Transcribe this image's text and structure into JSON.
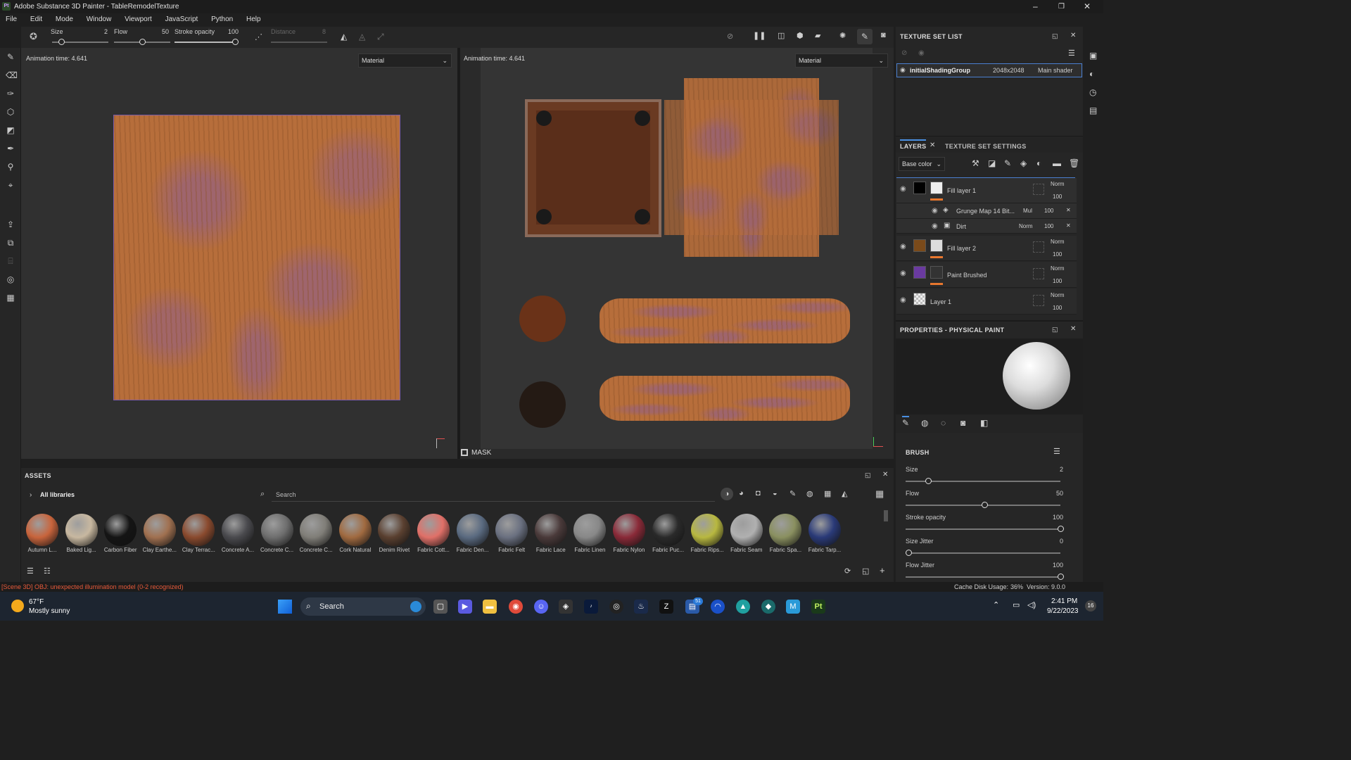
{
  "window": {
    "title": "Adobe Substance 3D Painter - TableRemodelTexture",
    "app_icon": "Pt"
  },
  "menu": [
    "File",
    "Edit",
    "Mode",
    "Window",
    "Viewport",
    "JavaScript",
    "Python",
    "Help"
  ],
  "toolbar": {
    "size_label": "Size",
    "size_value": "2",
    "flow_label": "Flow",
    "flow_value": "50",
    "opacity_label": "Stroke opacity",
    "opacity_value": "100",
    "distance_label": "Distance",
    "distance_value": "8"
  },
  "viewport_left": {
    "animation_time": "Animation time: 4.641",
    "channel": "Material"
  },
  "viewport_right": {
    "animation_time": "Animation time: 4.641",
    "channel": "Material",
    "mask_label": "MASK"
  },
  "texture_set_list": {
    "title": "TEXTURE SET LIST",
    "row": {
      "name": "initialShadingGroup",
      "resolution": "2048x2048",
      "shader": "Main shader"
    }
  },
  "layers": {
    "tab_layers": "LAYERS",
    "tab_settings": "TEXTURE SET SETTINGS",
    "channel": "Base color",
    "items": [
      {
        "name": "Fill layer 1",
        "blend": "Norm",
        "opacity": "100",
        "thumb_color": "#000000"
      },
      {
        "name": "Grunge Map 14 Bit...",
        "blend": "Mul",
        "opacity": "100"
      },
      {
        "name": "Dirt",
        "blend": "Norm",
        "opacity": "100"
      },
      {
        "name": "Fill layer 2",
        "blend": "Norm",
        "opacity": "100",
        "thumb_color": "#7a4a1a"
      },
      {
        "name": "Paint Brushed",
        "blend": "Norm",
        "opacity": "100",
        "thumb_color": "#6a3aa0"
      },
      {
        "name": "Layer 1",
        "blend": "Norm",
        "opacity": "100"
      }
    ]
  },
  "properties": {
    "title": "PROPERTIES - PHYSICAL PAINT",
    "section": "BRUSH",
    "params": [
      {
        "label": "Size",
        "value": "2",
        "fraction": 0.13
      },
      {
        "label": "Flow",
        "value": "50",
        "fraction": 0.5
      },
      {
        "label": "Stroke opacity",
        "value": "100",
        "fraction": 1.0
      },
      {
        "label": "Size Jitter",
        "value": "0",
        "fraction": 0.0
      },
      {
        "label": "Flow Jitter",
        "value": "100",
        "fraction": 1.0
      }
    ]
  },
  "assets": {
    "title": "ASSETS",
    "library": "All libraries",
    "search_placeholder": "Search",
    "materials": [
      {
        "label": "Autumn L...",
        "color": "#c8643c"
      },
      {
        "label": "Baked Lig...",
        "color": "#c8b8a0"
      },
      {
        "label": "Carbon Fiber",
        "color": "#141414"
      },
      {
        "label": "Clay Earthe...",
        "color": "#a07050"
      },
      {
        "label": "Clay Terrac...",
        "color": "#8a4a2e"
      },
      {
        "label": "Concrete A...",
        "color": "#4a4a4e"
      },
      {
        "label": "Concrete C...",
        "color": "#6e6e6e"
      },
      {
        "label": "Concrete C...",
        "color": "#807e78"
      },
      {
        "label": "Cork Natural",
        "color": "#a06a40"
      },
      {
        "label": "Denim Rivet",
        "color": "#5a4030"
      },
      {
        "label": "Fabric Cott...",
        "color": "#e07068"
      },
      {
        "label": "Fabric Den...",
        "color": "#5a6a80"
      },
      {
        "label": "Fabric Felt",
        "color": "#6a7080"
      },
      {
        "label": "Fabric Lace",
        "color": "#4a3a3a"
      },
      {
        "label": "Fabric Linen",
        "color": "#888888"
      },
      {
        "label": "Fabric Nylon",
        "color": "#8a2a38"
      },
      {
        "label": "Fabric Puc...",
        "color": "#2a2a2a"
      },
      {
        "label": "Fabric Rips...",
        "color": "#b8b840"
      },
      {
        "label": "Fabric Seam",
        "color": "#b0b0b0"
      },
      {
        "label": "Fabric Spa...",
        "color": "#8a9060"
      },
      {
        "label": "Fabric Tarp...",
        "color": "#2a3a78"
      }
    ]
  },
  "status": {
    "error": "[Scene 3D] OBJ: unexpected illumination model (0-2 recognized)",
    "cache": "Cache Disk Usage:",
    "cache_pct": "36%",
    "version": "Version: 9.0.0"
  },
  "taskbar": {
    "weather_temp": "67°F",
    "weather_desc": "Mostly sunny",
    "search": "Search",
    "time": "2:41 PM",
    "date": "9/22/2023",
    "badge_count": "51",
    "notif_count": "16"
  }
}
